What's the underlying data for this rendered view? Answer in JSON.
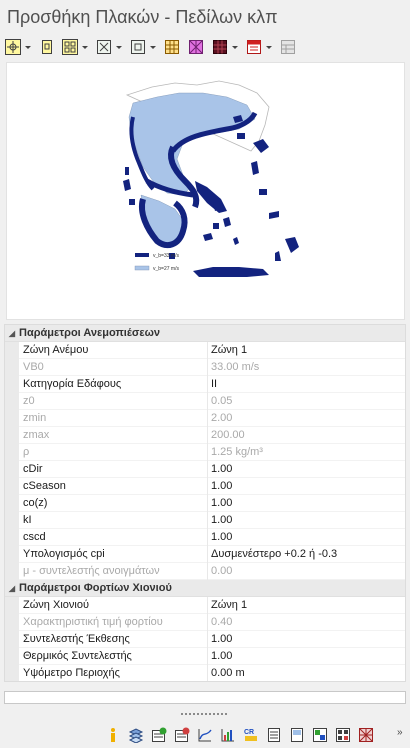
{
  "window": {
    "title": "Προσθήκη Πλακών - Πεδίλων κλπ"
  },
  "toolbar": {
    "buttons": [
      {
        "icon": "categorized-view-icon",
        "has_dropdown": true
      },
      {
        "icon": "sort-icon",
        "has_dropdown": false
      },
      {
        "icon": "grid-view-icon",
        "has_dropdown": true
      },
      {
        "icon": "select-all-icon",
        "has_dropdown": true
      },
      {
        "icon": "deselect-icon",
        "has_dropdown": true
      },
      {
        "icon": "table-icon",
        "has_dropdown": false
      },
      {
        "icon": "cross-grid-icon",
        "has_dropdown": false
      },
      {
        "icon": "dark-grid-icon",
        "has_dropdown": true
      },
      {
        "icon": "report-icon",
        "has_dropdown": true
      },
      {
        "icon": "disabled-table-icon",
        "has_dropdown": false
      }
    ]
  },
  "map": {
    "legend": [
      {
        "color": "#13237f",
        "label": "v_b=33 m/s"
      },
      {
        "color": "#a9c4e8",
        "label": "v_b=27 m/s"
      }
    ]
  },
  "wind": {
    "category": "Παράμετροι Ανεμοπιέσεων",
    "rows": [
      {
        "name": "Ζώνη Ανέμου",
        "value": "Ζώνη 1",
        "enabled": true
      },
      {
        "name": "VB0",
        "value": "33.00 m/s",
        "enabled": false
      },
      {
        "name": "Κατηγορία Εδάφους",
        "value": "II",
        "enabled": true
      },
      {
        "name": "z0",
        "value": "0.05",
        "enabled": false
      },
      {
        "name": "zmin",
        "value": "2.00",
        "enabled": false
      },
      {
        "name": "zmax",
        "value": "200.00",
        "enabled": false
      },
      {
        "name": "ρ",
        "value": "1.25 kg/m³",
        "enabled": false
      },
      {
        "name": "cDir",
        "value": "1.00",
        "enabled": true
      },
      {
        "name": "cSeason",
        "value": "1.00",
        "enabled": true
      },
      {
        "name": "co(z)",
        "value": "1.00",
        "enabled": true
      },
      {
        "name": "kI",
        "value": "1.00",
        "enabled": true
      },
      {
        "name": "cscd",
        "value": "1.00",
        "enabled": true
      },
      {
        "name": "Υπολογισμός cpi",
        "value": "Δυσμενέστερο +0.2 ή -0.3",
        "enabled": true
      },
      {
        "name": "μ - συντελεστής ανοιγμάτων",
        "value": "0.00",
        "enabled": false
      }
    ]
  },
  "snow": {
    "category": "Παράμετροι Φορτίων Χιονιού",
    "rows": [
      {
        "name": "Ζώνη Χιονιού",
        "value": "Ζώνη 1",
        "enabled": true
      },
      {
        "name": "Χαρακτηριστική τιμή φορτίου",
        "value": "0.40",
        "enabled": false
      },
      {
        "name": "Συντελεστής Έκθεσης",
        "value": "1.00",
        "enabled": true
      },
      {
        "name": "Θερμικός Συντελεστής",
        "value": "1.00",
        "enabled": true
      },
      {
        "name": "Υψόμετρο Περιοχής",
        "value": "0.00 m",
        "enabled": true
      }
    ]
  },
  "bottombar": {
    "icons": [
      "info-icon",
      "layers-icon",
      "import-icon",
      "export-icon",
      "chart-curve-icon",
      "bar-chart-icon",
      "cr-icon",
      "document-icon",
      "page-icon",
      "mixed-icon",
      "tiles-icon",
      "pattern-icon"
    ]
  }
}
